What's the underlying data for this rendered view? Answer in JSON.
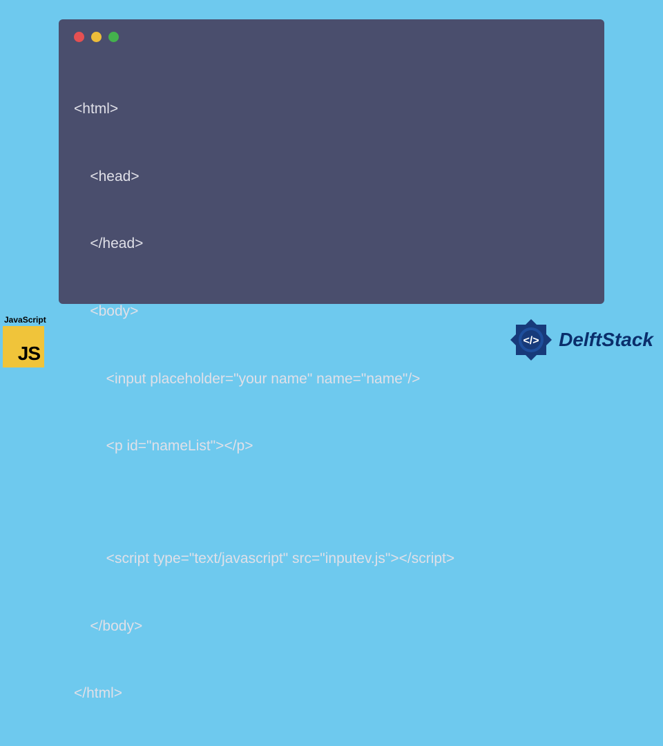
{
  "code": {
    "lines": [
      "<html>",
      "    <head>",
      "    </head>",
      "    <body>",
      "        <input placeholder=\"your name\" name=\"name\"/>",
      "        <p id=\"nameList\"></p>",
      "",
      "        <script type=\"text/javascript\" src=\"inputev.js\"></script>",
      "    </body>",
      "</html>"
    ]
  },
  "badges": {
    "js_label": "JavaScript",
    "js_icon_text": "JS",
    "delft_label": "DelftStack"
  },
  "window": {
    "dot_colors": [
      "#e55052",
      "#edbd3a",
      "#44b24d"
    ]
  }
}
